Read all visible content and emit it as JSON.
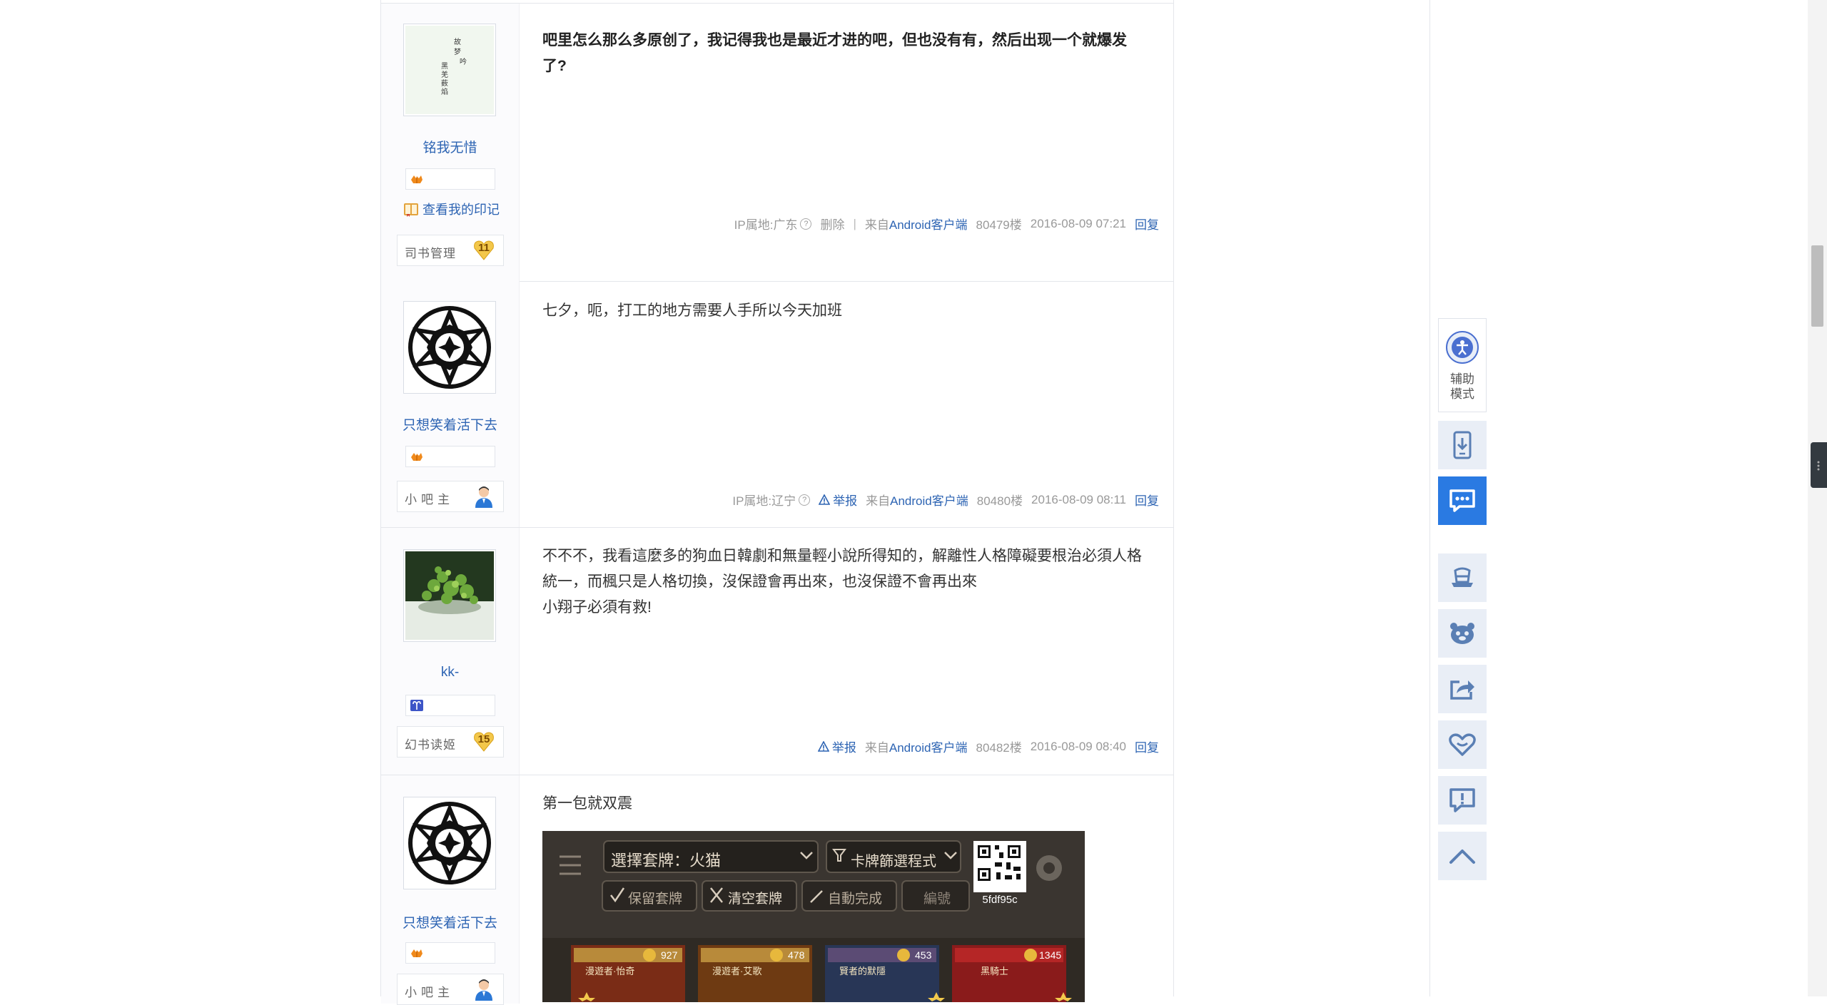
{
  "posts": [
    {
      "username": "铭我无惜",
      "avatar_text": "故梦吟 黑羌薮焰",
      "has_yinji": true,
      "yinji_label": "查看我的印记",
      "level_title": "司书管理",
      "level_num": "11",
      "content_lines": [
        "吧里怎么那么多原创了，我记得我也是最近才进的吧，但也没有有，然后出现一个就爆发",
        "了?"
      ],
      "ip": "IP属地:广东",
      "action": "删除",
      "separator": "|",
      "source": "来自",
      "client": "Android客户端",
      "floor": "80479楼",
      "time": "2016-08-09 07:21",
      "reply": "回复"
    },
    {
      "username": "只想笑着活下去",
      "level_title": "小吧主",
      "content_lines": [
        "七夕，呃，打工的地方需要人手所以今天加班"
      ],
      "ip": "IP属地:辽宁",
      "action": "举报",
      "source": "来自",
      "client": "Android客户端",
      "floor": "80480楼",
      "time": "2016-08-09 08:11",
      "reply": "回复"
    },
    {
      "username": "kk-",
      "level_title": "幻书读姬",
      "level_num": "15",
      "content_lines": [
        "不不不，我看這麼多的狗血日韓劇和無量輕小說所得知的，解離性人格障礙要根治必須人格",
        "統一，而楓只是人格切換，沒保證會再出來，也沒保證不會再出來",
        "小翔子必須有救!"
      ],
      "action": "举报",
      "source": "来自",
      "client": "Android客户端",
      "floor": "80482楼",
      "time": "2016-08-09 08:40",
      "reply": "回复"
    },
    {
      "username": "只想笑着活下去",
      "level_title": "小吧主",
      "content_lines": [
        "第一包就双震"
      ]
    }
  ],
  "game": {
    "select_deck": "選擇套牌：火猫",
    "filter_mode": "卡牌篩選程式",
    "keep_deck": "保留套牌",
    "clear_deck": "清空套牌",
    "auto_complete": "自動完成",
    "edit": "編號",
    "qr_code": "5fdf95c",
    "cards": [
      {
        "name": "漫遊者·怡奇",
        "cost": "927"
      },
      {
        "name": "漫遊者·艾歌",
        "cost": "478"
      },
      {
        "name": "賢者的默隱",
        "cost": "453"
      },
      {
        "name": "黑騎士",
        "cost": "1345"
      }
    ]
  },
  "sidebar": {
    "assist_label_1": "辅助",
    "assist_label_2": "模式"
  },
  "colors": {
    "link_blue": "#2d64b3",
    "active_blue": "#2a7ae2",
    "tool_bg": "#e9eef6"
  }
}
